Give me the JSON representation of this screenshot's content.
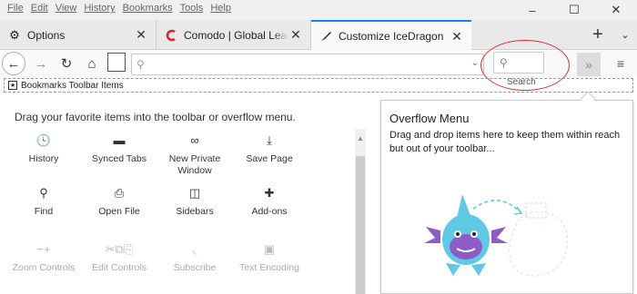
{
  "menubar": {
    "items": [
      "File",
      "Edit",
      "View",
      "History",
      "Bookmarks",
      "Tools",
      "Help"
    ],
    "minimize_glyph": "–",
    "maximize_glyph": "☐",
    "close_glyph": "✕"
  },
  "tabs": [
    {
      "label": "Options",
      "icon": "gear-icon",
      "close": "✕"
    },
    {
      "label": "Comodo | Global Leader in Cyber",
      "icon": "comodo-logo-icon",
      "close": "✕"
    },
    {
      "label": "Customize IceDragon",
      "icon": "paintbrush-icon",
      "close": "✕"
    }
  ],
  "tabstrip": {
    "new_tab_glyph": "+",
    "list_glyph": "⌄"
  },
  "navbar": {
    "back_glyph": "←",
    "forward_glyph": "→",
    "reload_glyph": "↻",
    "home_glyph": "⌂",
    "url_value": "",
    "search_placeholder": "",
    "search_label": "Search",
    "overflow_glyph": "»",
    "menu_glyph": "≡"
  },
  "bookmarks_toolbar": {
    "label": "Bookmarks Toolbar Items"
  },
  "palette": {
    "instructions": "Drag your favorite items into the toolbar or overflow menu.",
    "items": [
      {
        "label": "History",
        "icon": "history-clock-icon",
        "glyph": "🕓",
        "enabled": true
      },
      {
        "label": "Synced Tabs",
        "icon": "laptop-icon",
        "glyph": "▬",
        "enabled": true
      },
      {
        "label": "New Private Window",
        "icon": "mask-icon",
        "glyph": "∞",
        "enabled": true
      },
      {
        "label": "Save Page",
        "icon": "save-folder-icon",
        "glyph": "⤓",
        "enabled": true
      },
      {
        "label": "Find",
        "icon": "magnifier-icon",
        "glyph": "⚲",
        "enabled": true
      },
      {
        "label": "Open File",
        "icon": "open-folder-icon",
        "glyph": "⎙",
        "enabled": true
      },
      {
        "label": "Sidebars",
        "icon": "sidebar-icon",
        "glyph": "◫",
        "enabled": true
      },
      {
        "label": "Add-ons",
        "icon": "puzzle-icon",
        "glyph": "✚",
        "enabled": true
      },
      {
        "label": "Zoom Controls",
        "icon": "zoom-icon",
        "glyph": "−+",
        "enabled": false
      },
      {
        "label": "Edit Controls",
        "icon": "scissors-copy-paste-icon",
        "glyph": "✂⧉⎘",
        "enabled": false
      },
      {
        "label": "Subscribe",
        "icon": "rss-icon",
        "glyph": "◟",
        "enabled": false
      },
      {
        "label": "Text Encoding",
        "icon": "encoding-icon",
        "glyph": "▣",
        "enabled": false
      }
    ]
  },
  "overflow_panel": {
    "title": "Overflow Menu",
    "description": "Drag and drop items here to keep them within reach but out of your toolbar..."
  },
  "colors": {
    "accent": "#0a84ff",
    "callout": "#e12a2a",
    "comodo_red": "#d9232e",
    "dragon_teal": "#5fc9e6",
    "dragon_purple": "#8c5cc7"
  }
}
